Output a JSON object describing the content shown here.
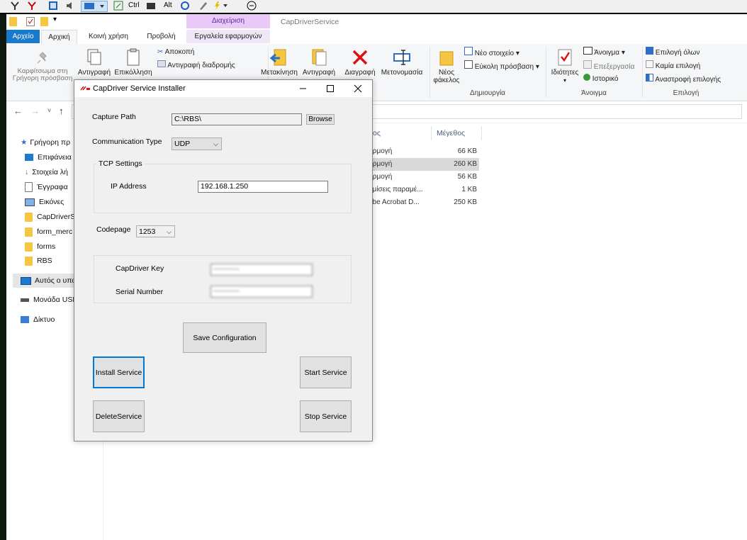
{
  "top_toolbar": {
    "ctrl_label": "Ctrl",
    "alt_label": "Alt"
  },
  "explorer": {
    "context_header": "Διαχείριση",
    "window_title": "CapDriverService",
    "tabs": [
      "Αρχείο",
      "Αρχική",
      "Κοινή χρήση",
      "Προβολή",
      "Εργαλεία εφαρμογών"
    ],
    "ribbon": {
      "pin_label": "Καρφίτσωμα στη Γρήγορη πρόσβαση",
      "copy_label": "Αντιγραφή",
      "paste_label": "Επικόλληση",
      "cut_label": "Αποκοπή",
      "copy_path_label": "Αντιγραφή διαδρομής",
      "move_label": "Μετακίνηση",
      "copy_to_label": "Αντιγραφή",
      "delete_label": "Διαγραφή",
      "rename_label": "Μετονομασία",
      "new_folder_label": "Νέος φάκελος",
      "new_item_label": "Νέο στοιχείο",
      "easy_access_label": "Εύκολη πρόσβαση",
      "create_group": "Δημιουργία",
      "properties_label": "Ιδιότητες",
      "open_label": "Άνοιγμα",
      "edit_label": "Επεξεργασία",
      "history_label": "Ιστορικό",
      "open_group": "Άνοιγμα",
      "select_all_label": "Επιλογή όλων",
      "select_none_label": "Καμία επιλογή",
      "invert_selection_label": "Αναστροφή επιλογής",
      "select_group": "Επιλογή"
    },
    "nav_items": [
      "Γρήγορη πρ",
      "Επιφάνεια",
      "Στοιχεία λή",
      "Έγγραφα",
      "Εικόνες",
      "CapDriverS",
      "form_merc",
      "forms",
      "RBS",
      "Αυτός ο υπο",
      "Μονάδα USB",
      "Δίκτυο"
    ],
    "columns": {
      "type": "τος",
      "size": "Μέγεθος"
    },
    "files": [
      {
        "type": "αρμογή",
        "size": "66 KB"
      },
      {
        "type": "αρμογή",
        "size": "260 KB"
      },
      {
        "type": "αρμογή",
        "size": "56 KB"
      },
      {
        "type": "θμίσεις παραμέ...",
        "size": "1 KB"
      },
      {
        "type": "obe Acrobat D...",
        "size": "250 KB"
      }
    ]
  },
  "dialog": {
    "title": "CapDriver Service Installer",
    "capture_path_label": "Capture Path",
    "capture_path_value": "C:\\RBS\\",
    "browse_label": "Browse",
    "communication_type_label": "Communication Type",
    "communication_type_value": "UDP",
    "tcp_group_title": "TCP Settings",
    "ip_label": "IP Address",
    "ip_value": "192.168.1.250",
    "codepage_label": "Codepage",
    "codepage_value": "1253",
    "key_label": "CapDriver Key",
    "key_value": "••••••••••",
    "serial_label": "Serial Number",
    "serial_value": "••••••••••",
    "save_label": "Save Configuration",
    "install_label": "Install Service",
    "start_label": "Start Service",
    "delete_label": "DeleteService",
    "stop_label": "Stop Service"
  },
  "colors": {
    "accent": "#1979ca",
    "context": "#e8c9f7",
    "selection": "#d9d9d9",
    "focus": "#0078d7"
  }
}
